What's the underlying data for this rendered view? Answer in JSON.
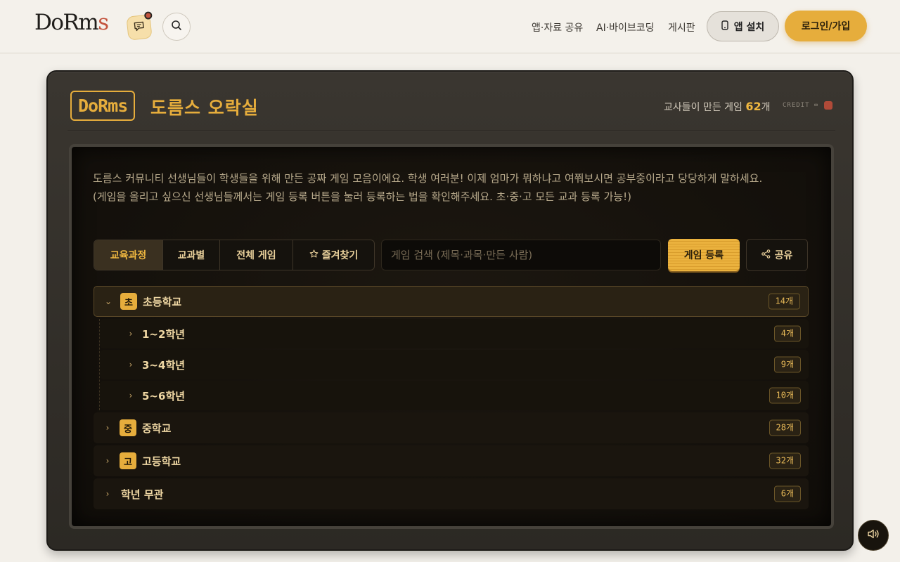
{
  "header": {
    "logo_main": "DoRm",
    "logo_accent": "s",
    "nav": [
      "앱·자료 공유",
      "AI·바이브코딩",
      "게시판"
    ],
    "install_label": "앱 설치",
    "login_label": "로그인/가입"
  },
  "arcade": {
    "badge": "DoRms",
    "title": "도름스 오락실",
    "count_prefix": "교사들이 만든 게임 ",
    "count_value": "62",
    "count_suffix": "개",
    "credit_label": "CREDIT ∞",
    "description": "도름스 커뮤니티 선생님들이 학생들을 위해 만든 공짜 게임 모음이에요. 학생 여러분! 이제 엄마가 뭐하냐고 여쭤보시면 공부중이라고 당당하게 말하세요. (게임을 올리고 싶으신 선생님들께서는 게임 등록 버튼을 눌러 등록하는 법을 확인해주세요. 초·중·고 모든 교과 등록 가능!)",
    "tabs": [
      "교육과정",
      "교과별",
      "전체 게임",
      "즐겨찾기"
    ],
    "search_placeholder": "게임 검색 (제목·과목·만든 사람)",
    "register_label": "게임 등록",
    "share_label": "공유",
    "tree": {
      "elementary": {
        "icon": "초",
        "label": "초등학교",
        "count": "14개",
        "expanded": true,
        "children": [
          {
            "label": "1~2학년",
            "count": "4개"
          },
          {
            "label": "3~4학년",
            "count": "9개"
          },
          {
            "label": "5~6학년",
            "count": "10개"
          }
        ]
      },
      "middle": {
        "icon": "중",
        "label": "중학교",
        "count": "28개"
      },
      "high": {
        "icon": "고",
        "label": "고등학교",
        "count": "32개"
      },
      "nograde": {
        "label": "학년 무관",
        "count": "6개"
      }
    }
  },
  "colors": {
    "accent": "#e6ad3c",
    "brand_red": "#c4543e",
    "screen_bg": "#100d09"
  }
}
